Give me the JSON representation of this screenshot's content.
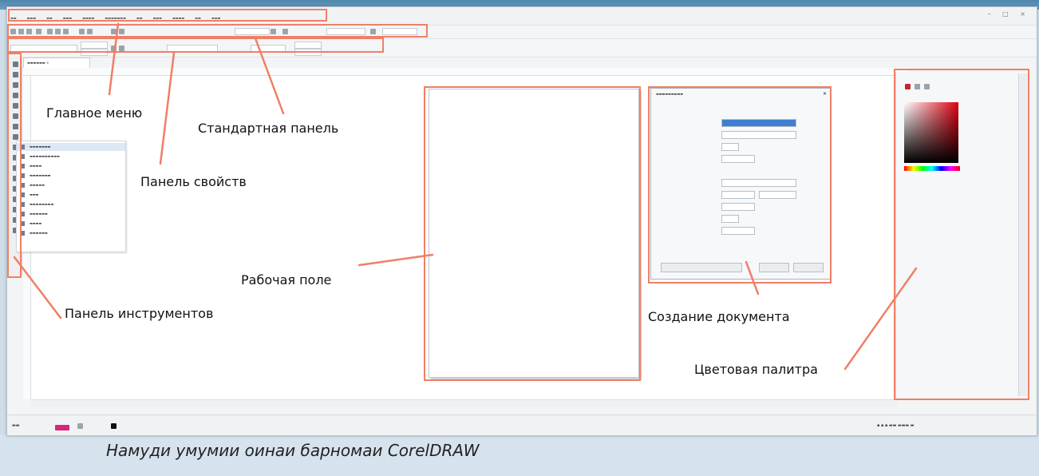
{
  "colors": {
    "accent": "#f07f66",
    "frame_blue": "#4d87ad",
    "caption_bg": "#d6e3ee"
  },
  "annotations": {
    "main_menu": "Главное меню",
    "standard_panel": "Стандартная панель",
    "property_panel": "Панель свойств",
    "workspace": "Рабочая поле",
    "toolbox": "Панель инструментов",
    "create_document": "Создание документа",
    "color_palette": "Цветовая палитра"
  },
  "caption": "Намуди умумии оинаи барномаи CorelDRAW"
}
